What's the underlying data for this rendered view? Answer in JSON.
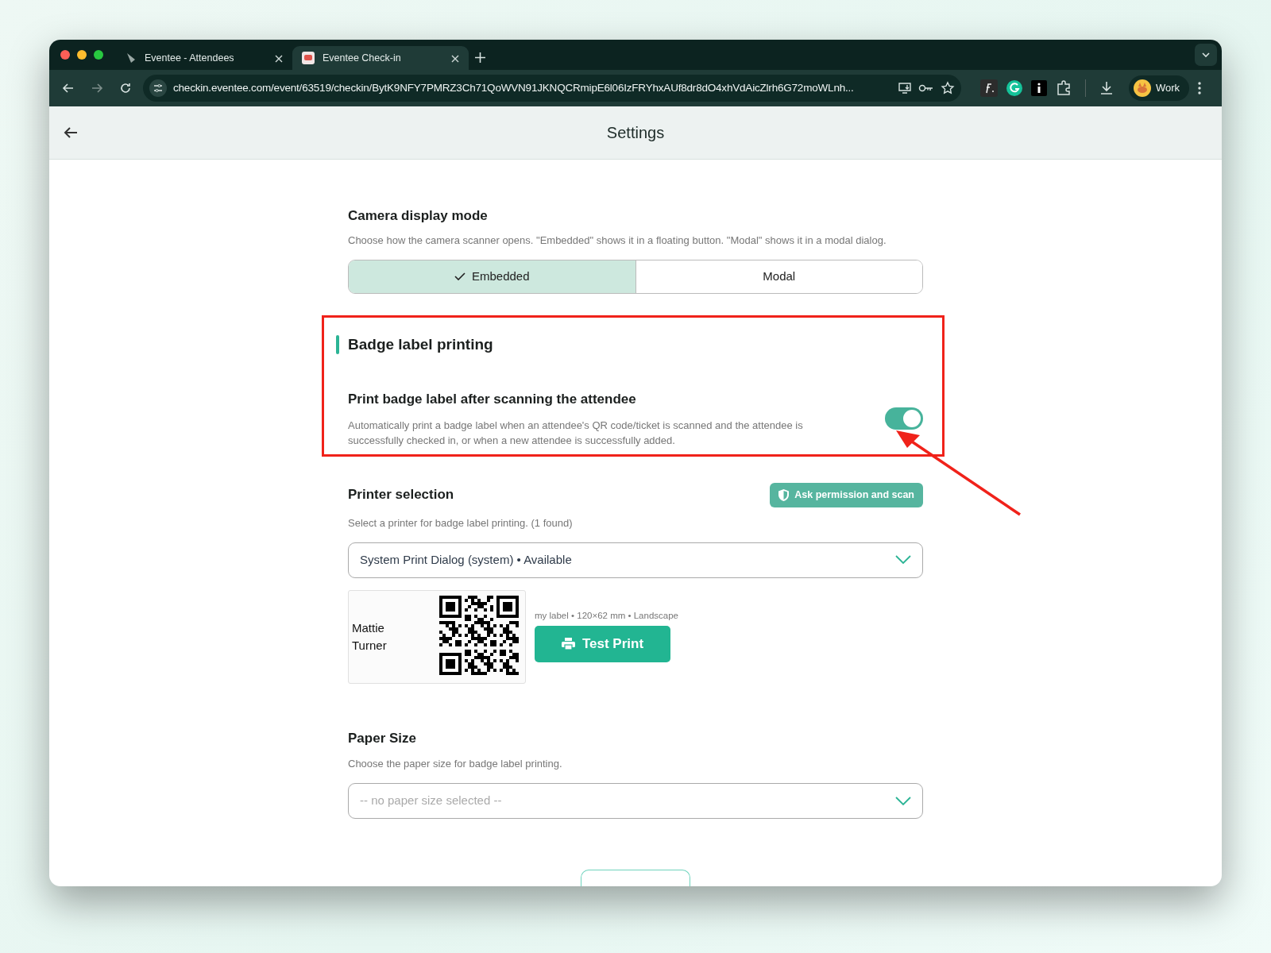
{
  "browser": {
    "tabs": [
      {
        "title": "Eventee - Attendees",
        "selected": false
      },
      {
        "title": "Eventee Check-in",
        "selected": true
      }
    ],
    "url": "checkin.eventee.com/event/63519/checkin/BytK9NFY7PMRZ3Ch71QoWVN91JKNQCRmipE6l06IzFRYhxAUf8dr8dO4xhVdAicZlrh6G72moWLnh...",
    "profile": "Work"
  },
  "page": {
    "title": "Settings"
  },
  "camera_mode": {
    "title": "Camera display mode",
    "description": "Choose how the camera scanner opens. \"Embedded\" shows it in a floating button. \"Modal\" shows it in a modal dialog.",
    "options": [
      {
        "label": "Embedded",
        "selected": true
      },
      {
        "label": "Modal",
        "selected": false
      }
    ]
  },
  "badge_printing": {
    "title": "Badge label printing",
    "setting": {
      "title": "Print badge label after scanning the attendee",
      "description": "Automatically print a badge label when an attendee's QR code/ticket is scanned and the attendee is successfully checked in, or when a new attendee is successfully added.",
      "on": true
    }
  },
  "printer": {
    "title": "Printer selection",
    "scan_button": "Ask permission and scan",
    "description": "Select a printer for badge label printing. (1 found)",
    "select": {
      "value": "System Print Dialog (system) • Available"
    },
    "preview": {
      "name_lines": [
        "Mattie",
        "Turner"
      ],
      "info": "my label • 120×62 mm • Landscape",
      "test_button": "Test Print"
    }
  },
  "paper": {
    "title": "Paper Size",
    "description": "Choose the paper size for badge label printing.",
    "select": {
      "placeholder": "-- no paper size selected --"
    }
  }
}
